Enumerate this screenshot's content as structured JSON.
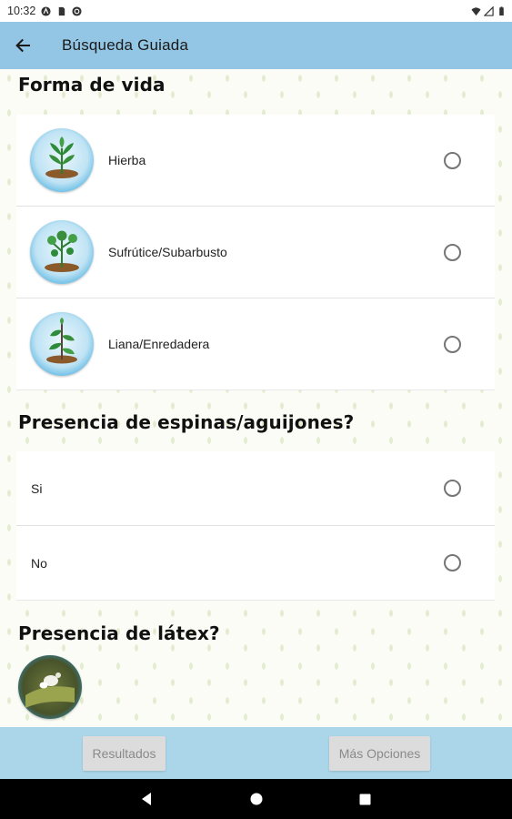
{
  "status_bar": {
    "time": "10:32"
  },
  "app_bar": {
    "title": "Búsqueda Guiada"
  },
  "sections": {
    "forma": {
      "title": "Forma de vida",
      "options": [
        {
          "label": "Hierba",
          "icon": "herb-icon"
        },
        {
          "label": "Sufrútice/Subarbusto",
          "icon": "subshrub-icon"
        },
        {
          "label": "Liana/Enredadera",
          "icon": "vine-icon"
        }
      ]
    },
    "espinas": {
      "title": "Presencia de espinas/aguijones?",
      "options": [
        {
          "label": "Si"
        },
        {
          "label": "No"
        }
      ]
    },
    "latex": {
      "title": "Presencia de látex?"
    }
  },
  "actions": {
    "results_label": "Resultados",
    "more_label": "Más Opciones"
  },
  "colors": {
    "app_bar": "#93c5e5",
    "bottom_bar": "#abd6ea",
    "button_disabled": "#dcdcdc"
  }
}
